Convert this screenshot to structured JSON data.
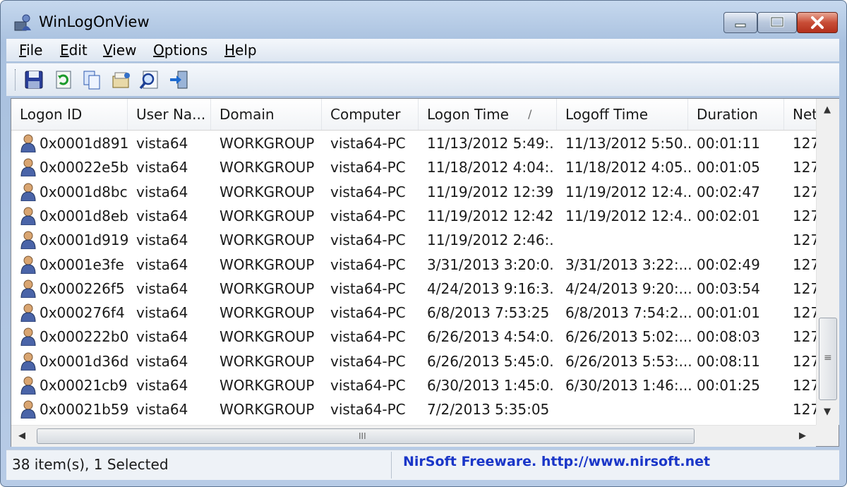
{
  "window": {
    "title": "WinLogOnView"
  },
  "menu": [
    {
      "label": "File"
    },
    {
      "label": "Edit"
    },
    {
      "label": "View"
    },
    {
      "label": "Options"
    },
    {
      "label": "Help"
    }
  ],
  "toolbar": [
    {
      "icon": "save-icon"
    },
    {
      "icon": "refresh-icon"
    },
    {
      "icon": "copy-icon"
    },
    {
      "icon": "properties-icon"
    },
    {
      "icon": "find-icon"
    },
    {
      "icon": "exit-icon"
    }
  ],
  "columns": [
    {
      "label": "Logon ID"
    },
    {
      "label": "User Na..."
    },
    {
      "label": "Domain"
    },
    {
      "label": "Computer"
    },
    {
      "label": "Logon Time",
      "sort": "/"
    },
    {
      "label": "Logoff Time"
    },
    {
      "label": "Duration"
    },
    {
      "label": "Net"
    }
  ],
  "rows": [
    [
      "0x0001d891",
      "vista64",
      "WORKGROUP",
      "vista64-PC",
      "11/13/2012 5:49:...",
      "11/13/2012 5:50...",
      "00:01:11",
      "127"
    ],
    [
      "0x00022e5b",
      "vista64",
      "WORKGROUP",
      "vista64-PC",
      "11/18/2012 4:04:...",
      "11/18/2012 4:05...",
      "00:01:05",
      "127"
    ],
    [
      "0x0001d8bc",
      "vista64",
      "WORKGROUP",
      "vista64-PC",
      "11/19/2012 12:39...",
      "11/19/2012 12:4...",
      "00:02:47",
      "127"
    ],
    [
      "0x0001d8eb",
      "vista64",
      "WORKGROUP",
      "vista64-PC",
      "11/19/2012 12:42...",
      "11/19/2012 12:4...",
      "00:02:01",
      "127"
    ],
    [
      "0x0001d919",
      "vista64",
      "WORKGROUP",
      "vista64-PC",
      "11/19/2012 2:46:...",
      "",
      "",
      "127"
    ],
    [
      "0x0001e3fe",
      "vista64",
      "WORKGROUP",
      "vista64-PC",
      "3/31/2013 3:20:0...",
      "3/31/2013 3:22:...",
      "00:02:49",
      "127"
    ],
    [
      "0x000226f5",
      "vista64",
      "WORKGROUP",
      "vista64-PC",
      "4/24/2013 9:16:3...",
      "4/24/2013 9:20:...",
      "00:03:54",
      "127"
    ],
    [
      "0x000276f4",
      "vista64",
      "WORKGROUP",
      "vista64-PC",
      "6/8/2013 7:53:25 ...",
      "6/8/2013 7:54:2...",
      "00:01:01",
      "127"
    ],
    [
      "0x000222b0",
      "vista64",
      "WORKGROUP",
      "vista64-PC",
      "6/26/2013 4:54:0...",
      "6/26/2013 5:02:...",
      "00:08:03",
      "127"
    ],
    [
      "0x0001d36d",
      "vista64",
      "WORKGROUP",
      "vista64-PC",
      "6/26/2013 5:45:0...",
      "6/26/2013 5:53:...",
      "00:08:11",
      "127"
    ],
    [
      "0x00021cb9",
      "vista64",
      "WORKGROUP",
      "vista64-PC",
      "6/30/2013 1:45:0...",
      "6/30/2013 1:46:...",
      "00:01:25",
      "127"
    ],
    [
      "0x00021b59",
      "vista64",
      "WORKGROUP",
      "vista64-PC",
      "7/2/2013 5:35:05 ...",
      "",
      "",
      "127"
    ]
  ],
  "scrollbars": {
    "grip": "III",
    "vgrip": "≡"
  },
  "status": {
    "items": "38 item(s), 1 Selected",
    "credit": "NirSoft Freeware.  http://www.nirsoft.net"
  }
}
